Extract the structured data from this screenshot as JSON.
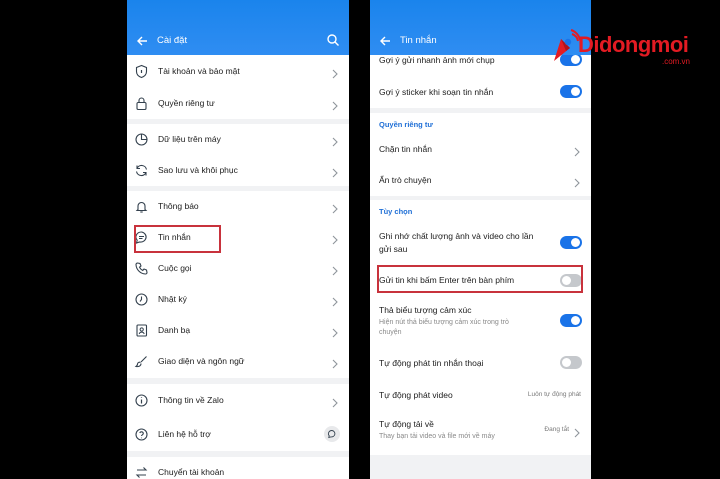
{
  "left": {
    "header_title": "Cài đặt",
    "items": [
      {
        "label": "Tài khoản và bảo mật",
        "icon": "shield-icon"
      },
      {
        "label": "Quyền riêng tư",
        "icon": "lock-icon"
      },
      {
        "label": "Dữ liệu trên máy",
        "icon": "pie-chart-icon"
      },
      {
        "label": "Sao lưu và khôi phục",
        "icon": "sync-icon"
      },
      {
        "label": "Thông báo",
        "icon": "bell-icon"
      },
      {
        "label": "Tin nhắn",
        "icon": "chat-icon"
      },
      {
        "label": "Cuộc gọi",
        "icon": "phone-icon"
      },
      {
        "label": "Nhật ký",
        "icon": "clock-icon"
      },
      {
        "label": "Danh bạ",
        "icon": "contacts-icon"
      },
      {
        "label": "Giao diện và ngôn ngữ",
        "icon": "brush-icon"
      },
      {
        "label": "Thông tin về Zalo",
        "icon": "info-icon"
      },
      {
        "label": "Liên hệ hỗ trợ",
        "icon": "help-icon"
      },
      {
        "label": "Chuyển tài khoản",
        "icon": "switch-account-icon"
      }
    ]
  },
  "right": {
    "header_title": "Tin nhắn",
    "top_rows": [
      {
        "label": "Gợi ý gửi nhanh ảnh mới chụp",
        "toggle": "on"
      },
      {
        "label": "Gợi ý sticker khi soạn tin nhắn",
        "toggle": "on"
      }
    ],
    "privacy": {
      "title": "Quyền riêng tư",
      "rows": [
        {
          "label": "Chặn tin nhắn"
        },
        {
          "label": "Ẩn trò chuyện"
        }
      ]
    },
    "options": {
      "title": "Tùy chọn",
      "quality_line1": "Ghi nhớ chất lượng ảnh và video cho lần",
      "quality_line2": "gửi sau",
      "enter_send": "Gửi tin khi bấm Enter trên bàn phím",
      "reactions": "Thả biểu tượng cảm xúc",
      "reactions_sub1": "Hiện nút thả biểu tượng cảm xúc trong trò",
      "reactions_sub2": "chuyện",
      "autoplay_voice": "Tự động phát tin nhắn thoại",
      "autoplay_video": "Tự động phát video",
      "autoplay_video_value": "Luôn tự động phát",
      "autodownload": "Tự động tải về",
      "autodownload_sub": "Thay bạn tải video và file mới về máy",
      "autodownload_value": "Đang tắt"
    },
    "toggles": {
      "quality": "on",
      "enter_send": "off",
      "reactions": "on",
      "autoplay_voice": "off"
    }
  },
  "watermark": {
    "brand": "Didongmoi",
    "domain": ".com.vn"
  },
  "colors": {
    "header_blue": "#1a84ec",
    "toggle_on": "#1a73e8",
    "highlight_red": "#c8323c",
    "brand_red": "#e31b23"
  }
}
